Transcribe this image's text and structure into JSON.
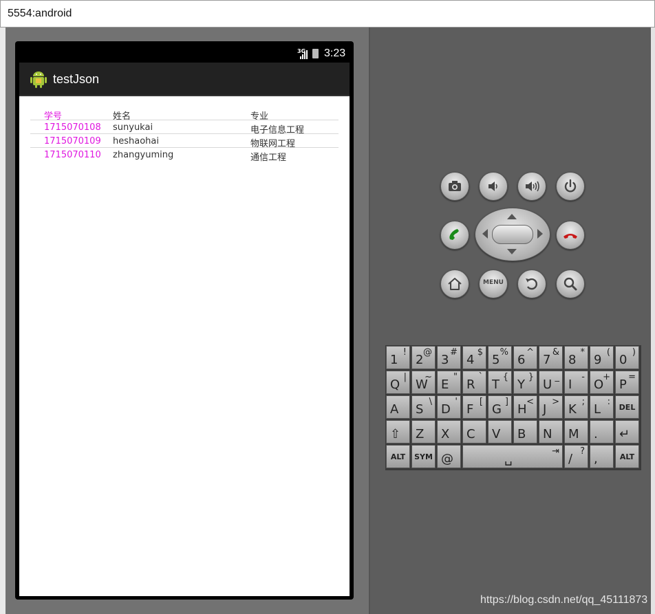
{
  "window": {
    "title": "5554:android"
  },
  "statusbar": {
    "network": "3G",
    "time": "3:23"
  },
  "app": {
    "title": "testJson"
  },
  "table": {
    "headers": [
      "学号",
      "姓名",
      "专业"
    ],
    "rows": [
      [
        "1715070108",
        "sunyukai",
        "电子信息工程"
      ],
      [
        "1715070109",
        "heshaohai",
        "物联网工程"
      ],
      [
        "1715070110",
        "zhangyuming",
        "通信工程"
      ]
    ]
  },
  "controls": {
    "menu_label": "MENU"
  },
  "keyboard": {
    "rows": [
      [
        [
          "1",
          "!"
        ],
        [
          "2",
          "@"
        ],
        [
          "3",
          "#"
        ],
        [
          "4",
          "$"
        ],
        [
          "5",
          "%"
        ],
        [
          "6",
          "^"
        ],
        [
          "7",
          "&"
        ],
        [
          "8",
          "*"
        ],
        [
          "9",
          "("
        ],
        [
          "0",
          ")"
        ]
      ],
      [
        [
          "Q",
          "|"
        ],
        [
          "W",
          "~"
        ],
        [
          "E",
          "\""
        ],
        [
          "R",
          "`"
        ],
        [
          "T",
          "{"
        ],
        [
          "Y",
          "}"
        ],
        [
          "U",
          "_"
        ],
        [
          "I",
          "-"
        ],
        [
          "O",
          "+"
        ],
        [
          "P",
          "="
        ]
      ],
      [
        [
          "A",
          ""
        ],
        [
          "S",
          "\\"
        ],
        [
          "D",
          "'"
        ],
        [
          "F",
          "["
        ],
        [
          "G",
          "]"
        ],
        [
          "H",
          "<"
        ],
        [
          "J",
          ">"
        ],
        [
          "K",
          ";"
        ],
        [
          "L",
          ":"
        ],
        [
          "DEL",
          ""
        ]
      ],
      [
        [
          "⇧",
          ""
        ],
        [
          "Z",
          ""
        ],
        [
          "X",
          ""
        ],
        [
          "C",
          ""
        ],
        [
          "V",
          ""
        ],
        [
          "B",
          ""
        ],
        [
          "N",
          ""
        ],
        [
          "M",
          ""
        ],
        [
          ".",
          ""
        ],
        [
          "↵",
          ""
        ]
      ],
      [
        [
          "ALT",
          ""
        ],
        [
          "SYM",
          ""
        ],
        [
          "@",
          ""
        ],
        [
          "␣",
          "⇥"
        ],
        [
          "/",
          "?"
        ],
        [
          ",",
          ""
        ],
        [
          "ALT",
          ""
        ]
      ]
    ]
  },
  "watermark": "https://blog.csdn.net/qq_45111873",
  "colors": {
    "id_column": "#e016e0",
    "accent_green": "#1a8a1a",
    "accent_red": "#c81818"
  }
}
